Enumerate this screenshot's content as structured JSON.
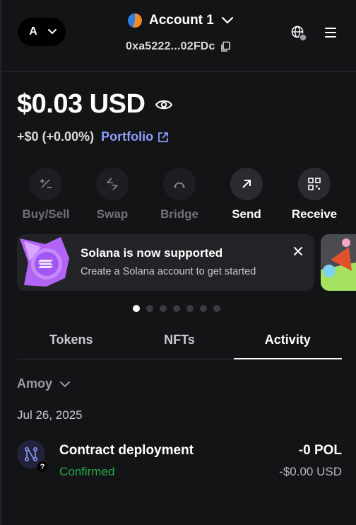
{
  "header": {
    "network_initial": "A",
    "account_name": "Account 1",
    "address": "0xa5222...02FDc"
  },
  "balance": {
    "value": "$0.03 USD",
    "change": "+$0 (+0.00%)",
    "portfolio_label": "Portfolio"
  },
  "actions": [
    {
      "label": "Buy/Sell",
      "enabled": false
    },
    {
      "label": "Swap",
      "enabled": false
    },
    {
      "label": "Bridge",
      "enabled": false
    },
    {
      "label": "Send",
      "enabled": true
    },
    {
      "label": "Receive",
      "enabled": true
    }
  ],
  "banner": {
    "title": "Solana is now supported",
    "subtitle": "Create a Solana account to get started"
  },
  "carousel": {
    "count": 7,
    "active": 0
  },
  "tabs": [
    {
      "label": "Tokens"
    },
    {
      "label": "NFTs"
    },
    {
      "label": "Activity",
      "active": true
    }
  ],
  "filter": {
    "network": "Amoy"
  },
  "activity": {
    "date": "Jul 26, 2025",
    "items": [
      {
        "title": "Contract deployment",
        "status": "Confirmed",
        "amount": "-0 POL",
        "fiat": "-$0.00 USD"
      }
    ]
  },
  "colors": {
    "background": "#131416",
    "accent": "#8e9dfd",
    "success": "#28a745",
    "banner_purple": "#a257f5"
  }
}
